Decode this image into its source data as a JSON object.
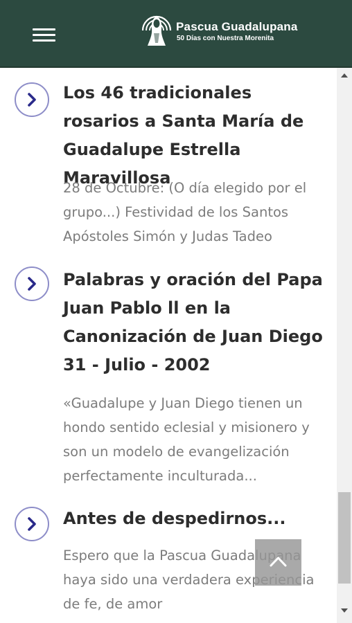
{
  "header": {
    "title": "Pascua Guadalupana",
    "subtitle": "50 Días con Nuestra Morenita",
    "background": "#2c4a40"
  },
  "articles": [
    {
      "title": "Los 46 tradicionales rosarios a Santa María de Guadalupe Estrella Maravillosa",
      "excerpt": "28 de Octubre: (O día elegido por el grupo...) Festividad de los Santos Apóstoles Simón y Judas Tadeo",
      "icon": "chevron-right-icon"
    },
    {
      "title": "Palabras y oración del Papa Juan Pablo ll en la Canonización de Juan Diego 31 - Julio - 2002",
      "excerpt": "«Guadalupe y Juan Diego tienen un hondo sentido eclesial y misionero y son un modelo de evangelización perfectamente inculturada...",
      "icon": "chevron-right-icon"
    },
    {
      "title": "Antes de despedirnos...",
      "excerpt": "Espero que la Pascua Guadalupana haya sido una verdadera experiencia de fe, de amor",
      "icon": "chevron-right-icon"
    }
  ],
  "colors": {
    "accent": "#2a2a8a",
    "title_text": "#2d2d2d",
    "excerpt_text": "#7c7c7c",
    "back_to_top": "#969696"
  },
  "icons": {
    "menu": "hamburger-menu-icon",
    "back_to_top": "chevron-up-icon",
    "logo": "guadalupe-logo-icon"
  }
}
